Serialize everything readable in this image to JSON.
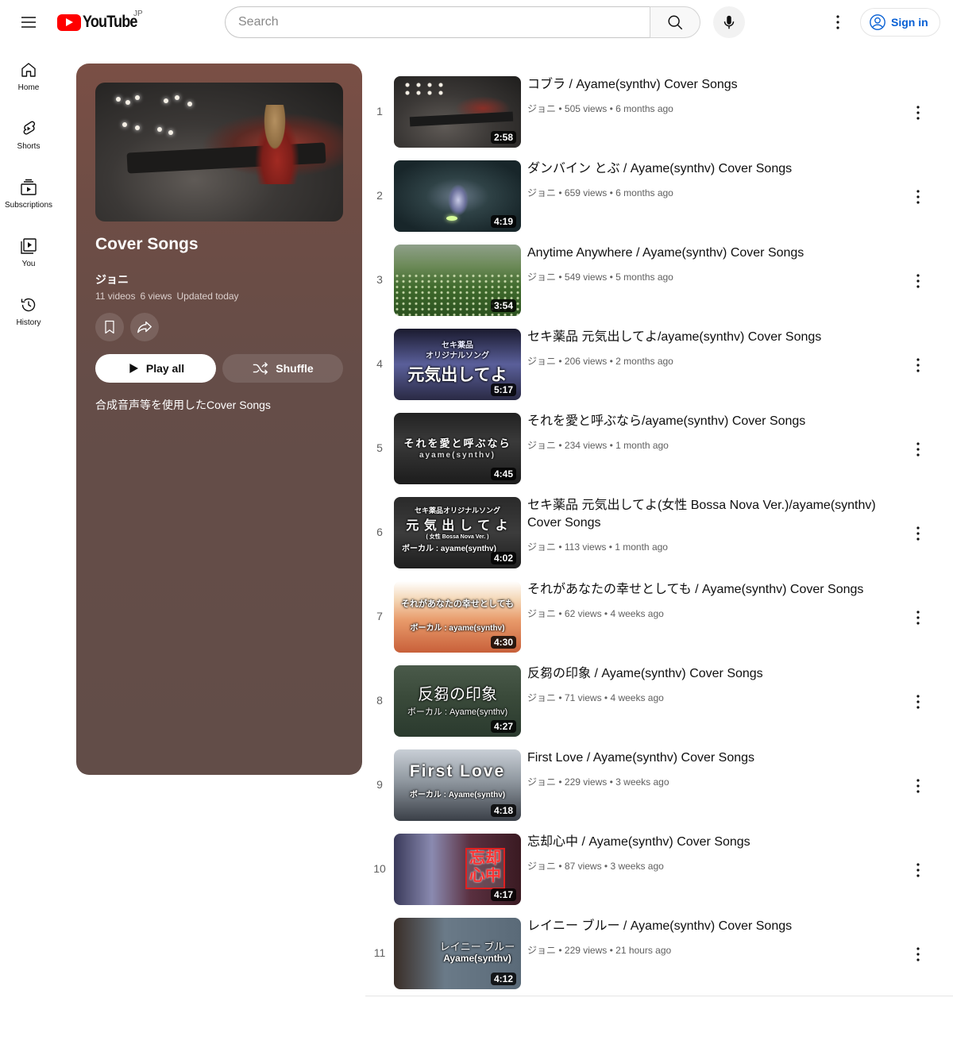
{
  "header": {
    "logo_text": "YouTube",
    "country_code": "JP",
    "search_placeholder": "Search",
    "signin_label": "Sign in"
  },
  "sidebar": {
    "items": [
      {
        "label": "Home",
        "icon": "home-icon"
      },
      {
        "label": "Shorts",
        "icon": "shorts-icon"
      },
      {
        "label": "Subscriptions",
        "icon": "subscriptions-icon"
      },
      {
        "label": "You",
        "icon": "you-icon"
      },
      {
        "label": "History",
        "icon": "history-icon"
      }
    ]
  },
  "playlist": {
    "title": "Cover Songs",
    "owner": "ジョニ",
    "video_count": "11 videos",
    "views": "6 views",
    "updated": "Updated today",
    "play_all_label": "Play all",
    "shuffle_label": "Shuffle",
    "description": "合成音声等を使用したCover Songs"
  },
  "colors": {
    "panel_bg": "#654d48",
    "signin_blue": "#065fd4",
    "logo_red": "#ff0000"
  },
  "videos": [
    {
      "index": "1",
      "title": "コブラ / Ayame(synthv) Cover Songs",
      "channel": "ジョニ",
      "views": "505 views",
      "age": "6 months ago",
      "duration": "2:58"
    },
    {
      "index": "2",
      "title": "ダンバイン とぶ / Ayame(synthv) Cover Songs",
      "channel": "ジョニ",
      "views": "659 views",
      "age": "6 months ago",
      "duration": "4:19"
    },
    {
      "index": "3",
      "title": "Anytime Anywhere / Ayame(synthv) Cover Songs",
      "channel": "ジョニ",
      "views": "549 views",
      "age": "5 months ago",
      "duration": "3:54"
    },
    {
      "index": "4",
      "title": "セキ薬品 元気出してよ/ayame(synthv) Cover Songs",
      "channel": "ジョニ",
      "views": "206 views",
      "age": "2 months ago",
      "duration": "5:17",
      "thumb_text": [
        "セキ薬品",
        "オリジナルソング",
        "元気出してよ"
      ]
    },
    {
      "index": "5",
      "title": "それを愛と呼ぶなら/ayame(synthv) Cover Songs",
      "channel": "ジョニ",
      "views": "234 views",
      "age": "1 month ago",
      "duration": "4:45",
      "thumb_text": [
        "それを愛と呼ぶなら",
        "ayame(synthv)"
      ]
    },
    {
      "index": "6",
      "title": "セキ薬品 元気出してよ(女性 Bossa Nova Ver.)/ayame(synthv) Cover Songs",
      "channel": "ジョニ",
      "views": "113 views",
      "age": "1 month ago",
      "duration": "4:02",
      "thumb_text": [
        "セキ薬品オリジナルソング",
        "元 気 出 し て よ",
        "( 女性 Bossa Nova Ver. )",
        "ボーカル : ayame(synthv)"
      ]
    },
    {
      "index": "7",
      "title": "それがあなたの幸せとしても / Ayame(synthv) Cover Songs",
      "channel": "ジョニ",
      "views": "62 views",
      "age": "4 weeks ago",
      "duration": "4:30",
      "thumb_text": [
        "それがあなたの幸せとしても",
        "ボーカル : ayame(synthv)"
      ]
    },
    {
      "index": "8",
      "title": "反芻の印象 / Ayame(synthv) Cover Songs",
      "channel": "ジョニ",
      "views": "71 views",
      "age": "4 weeks ago",
      "duration": "4:27",
      "thumb_text": [
        "反芻の印象",
        "ボーカル : Ayame(synthv)"
      ]
    },
    {
      "index": "9",
      "title": "First Love / Ayame(synthv) Cover Songs",
      "channel": "ジョニ",
      "views": "229 views",
      "age": "3 weeks ago",
      "duration": "4:18",
      "thumb_text": [
        "First Love",
        "ボーカル : Ayame(synthv)"
      ]
    },
    {
      "index": "10",
      "title": "忘却心中 / Ayame(synthv) Cover Songs",
      "channel": "ジョニ",
      "views": "87 views",
      "age": "3 weeks ago",
      "duration": "4:17",
      "thumb_text": [
        "忘却",
        "心中"
      ]
    },
    {
      "index": "11",
      "title": "レイニー ブルー / Ayame(synthv) Cover Songs",
      "channel": "ジョニ",
      "views": "229 views",
      "age": "21 hours ago",
      "duration": "4:12",
      "thumb_text": [
        "レイニー ブルー",
        "Ayame(synthv)"
      ]
    }
  ]
}
